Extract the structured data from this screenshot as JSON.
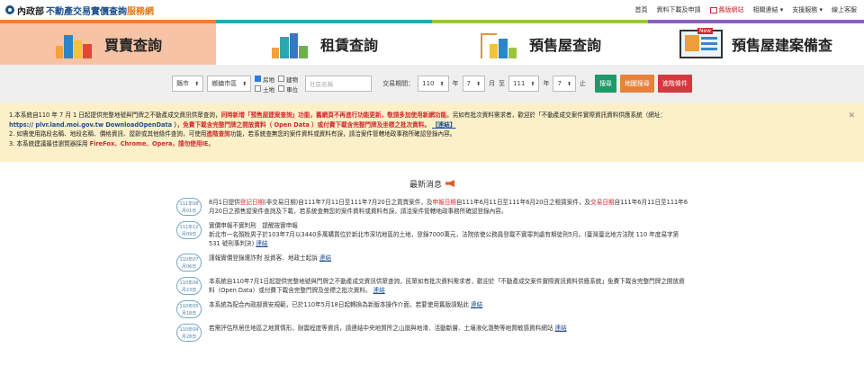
{
  "header": {
    "ministry": "內政部",
    "site_name": "不動產交易實價查詢",
    "site_suffix": "服務網",
    "nav": [
      "首頁",
      "資料下載及申請",
      "舊版網站",
      "相關連結 ▾",
      "支援服務 ▾",
      "線上客服"
    ]
  },
  "tabs": [
    {
      "label": "買賣查詢",
      "color": "#f07c3c"
    },
    {
      "label": "租賃查詢",
      "color": "#2aa7b1"
    },
    {
      "label": "預售屋查詢",
      "color": "#9bc53d"
    },
    {
      "label": "預售屋建案備查",
      "color": "#8a5fbf",
      "tag": "New"
    }
  ],
  "search": {
    "county": "縣市",
    "district": "鄉鎮市區",
    "checks": [
      {
        "label": "房地",
        "checked": true
      },
      {
        "label": "建物",
        "checked": false
      },
      {
        "label": "土地",
        "checked": false
      },
      {
        "label": "車位",
        "checked": false
      }
    ],
    "community_placeholder": "社區名稱",
    "period_label": "交易期間：",
    "from_year": "110",
    "from_month": "7",
    "to_year": "111",
    "to_month": "7",
    "year_unit": "年",
    "month_unit": "月",
    "to_word": "至",
    "until_word": "止",
    "btn_search": "搜尋",
    "btn_map": "地圖搜尋",
    "btn_advanced": "進階條件"
  },
  "notice": {
    "l1a": "1.本系統自110 年 7 月 1 日起提供完整地號與門牌之不動產成交資訊供眾查詢，",
    "l1b": "同時新增「預售屋建案查詢」功能，舊網頁不再進行功能更新，敬請多加使用新網功能",
    "l1c": "。另如有批次資料需求者，歡迎於「不動產成交案件實際資訊資料供應系統（網址：",
    "l2a": "https:// plvr.land.moi.gov.tw DownloadOpenData ）",
    "l2b": "，免費下載含完整門牌之開放資料（ Open Data ）或付費下載含完整門牌及坐標之批次資料。",
    "l2link": "【連結】",
    "l3a": "2. 如需使用路段名稱、地段名稱、價格資訊、屋齡或其他條件查詢，可使用",
    "l3b": "進階查詢",
    "l3c": "功能，若系統查無您的案件資料或資料有誤，請洽案件管轄地政事務所確認登錄內容。",
    "l4a": "3. 本系統建議最佳瀏覽器採用 ",
    "l4b": "FireFox、Chrome、Opera",
    "l4c": "，請勿使用IE",
    "l4d": "。"
  },
  "news": {
    "title": "最新消息",
    "items": [
      {
        "date1": "111年08",
        "date2": "月01日",
        "parts": [
          "8月1日提供",
          "登記日期",
          "(非交易日期)自111年7月11日至111年7月20日之買賣案件，及",
          "申報日期",
          "自111年6月11日至111年6月20日之租賃案件，及",
          "交易日期",
          "自111年6月11日至111年6月20日之預售屋案件查詢及下載，若系統查無您的案件資料或資料有誤，請洽案件管轄地政事務所確認登錄內容。"
        ],
        "link": ""
      },
      {
        "date1": "111年12",
        "date2": "月09日",
        "parts": [
          "實價申報不實判刑　提醒按實申報",
          "新北市一名顏姓男子於103年7月以3440多萬購買位於新北市深坑地區的土地，登錄7000萬元，法院依使公務員登載不實罪判處有期徒刑5月。(臺灣臺北地方法院 110 年度易字第 531 號刑事判決) "
        ],
        "link": "連結"
      },
      {
        "date1": "110年07",
        "date2": "月06日",
        "parts": [
          "謹報實價登錄遭詐對 投資客、地政士起訴 "
        ],
        "link": "連結"
      },
      {
        "date1": "110年06",
        "date2": "月23日",
        "parts": [
          "本系統自110年7月1日起提供完整地號與門牌之不動產成交資訊供眾查詢，民眾如有批次資料需求者，歡迎於「不動產成交案件實際資訊資料供應系統」免費下載含完整門牌之開放資料（Open Data）或付費下載含完整門牌及坐標之批次資料。 "
        ],
        "link": "連結"
      },
      {
        "date1": "110年05",
        "date2": "月18日",
        "parts": [
          "本系統為配合內政部資安規範，已於110年5月18日起轉換為新版本操作介面，若要使用舊版請點此 "
        ],
        "link": "連結"
      },
      {
        "date1": "110年04",
        "date2": "月28日",
        "parts": [
          "若需評估所居住地區之地質情形，耐震程度等資訊，請連結中央地質所之山崩與地滑、活動斷層、土壤液化潛勢等地質敏感資料網站 "
        ],
        "link": "連結"
      }
    ]
  }
}
